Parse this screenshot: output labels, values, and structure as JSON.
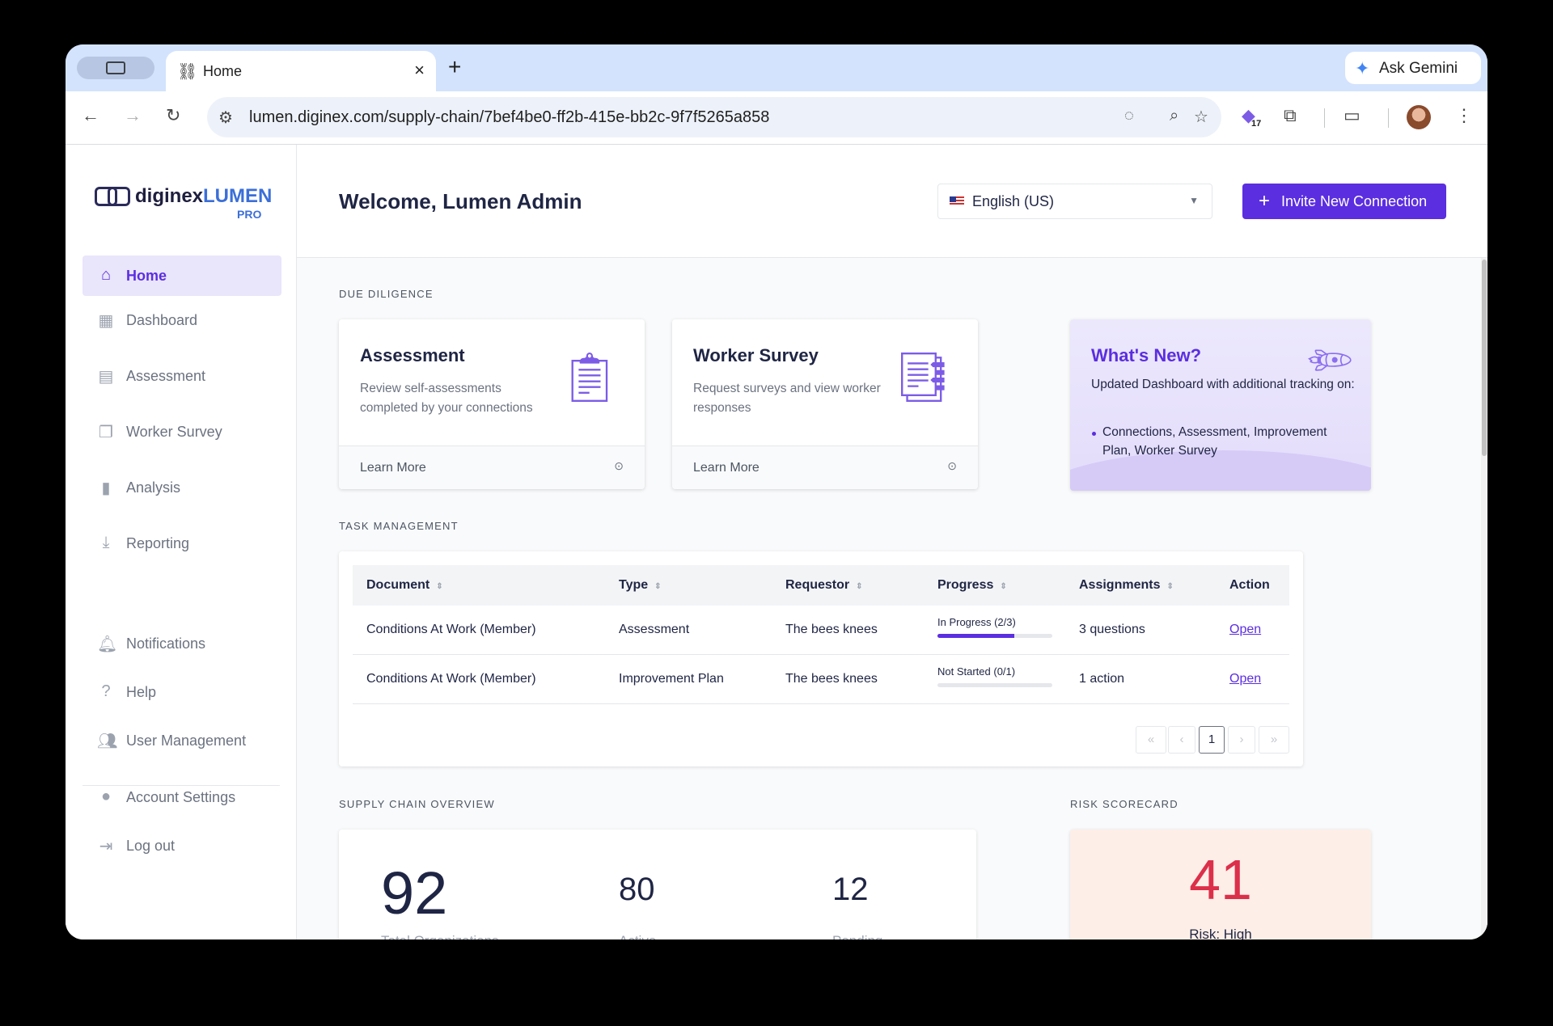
{
  "browser": {
    "tab_title": "Home",
    "new_tab": "+",
    "ask_gemini": "Ask Gemini",
    "url": "lumen.diginex.com/supply-chain/7bef4be0-ff2b-415e-bb2c-9f7f5265a858",
    "extension_badge": "17"
  },
  "brand": {
    "name_part1": "diginex",
    "name_part2": "LUMEN",
    "tier": "PRO"
  },
  "sidebar": {
    "items": [
      {
        "label": "Home",
        "icon": "home-icon"
      },
      {
        "label": "Dashboard",
        "icon": "dashboard-icon"
      },
      {
        "label": "Assessment",
        "icon": "assessment-icon"
      },
      {
        "label": "Worker Survey",
        "icon": "worker-survey-icon"
      },
      {
        "label": "Analysis",
        "icon": "bar-chart-icon"
      },
      {
        "label": "Reporting",
        "icon": "download-icon"
      }
    ],
    "bottom_items": [
      {
        "label": "Notifications",
        "icon": "bell-icon"
      },
      {
        "label": "Help",
        "icon": "help-icon"
      },
      {
        "label": "User Management",
        "icon": "users-icon"
      },
      {
        "label": "Account Settings",
        "icon": "account-icon"
      },
      {
        "label": "Log out",
        "icon": "logout-icon"
      }
    ]
  },
  "header": {
    "welcome": "Welcome, Lumen Admin",
    "language": "English (US)",
    "invite_button": "Invite New Connection"
  },
  "due_diligence": {
    "section_title": "DUE DILIGENCE",
    "cards": [
      {
        "title": "Assessment",
        "description": "Review self-assessments completed by your connections",
        "link": "Learn More"
      },
      {
        "title": "Worker Survey",
        "description": "Request surveys and view worker responses",
        "link": "Learn More"
      }
    ],
    "whats_new": {
      "title": "What's New?",
      "text": "Updated Dashboard with additional tracking on:",
      "bullet": "Connections, Assessment, Improvement Plan, Worker Survey"
    }
  },
  "task_management": {
    "section_title": "TASK MANAGEMENT",
    "columns": [
      "Document",
      "Type",
      "Requestor",
      "Progress",
      "Assignments",
      "Action"
    ],
    "rows": [
      {
        "document": "Conditions At Work (Member)",
        "type": "Assessment",
        "requestor": "The bees knees",
        "progress_label": "In Progress (2/3)",
        "progress": 0.667,
        "assignments": "3 questions",
        "action": "Open"
      },
      {
        "document": "Conditions At Work (Member)",
        "type": "Improvement Plan",
        "requestor": "The bees knees",
        "progress_label": "Not Started (0/1)",
        "progress": 0,
        "assignments": "1 action",
        "action": "Open"
      }
    ],
    "pagination": {
      "first": "«",
      "prev": "‹",
      "current": "1",
      "next": "›",
      "last": "»"
    }
  },
  "supply_chain": {
    "section_title": "SUPPLY CHAIN OVERVIEW",
    "total": "92",
    "total_label": "Total Organizations",
    "active": "80",
    "active_label": "Active",
    "pending": "12",
    "pending_label": "Pending"
  },
  "risk": {
    "section_title": "RISK SCORECARD",
    "score": "41",
    "label": "Risk: High"
  },
  "colors": {
    "accent": "#5b2ee0",
    "risk_high": "#dc2f4a"
  }
}
